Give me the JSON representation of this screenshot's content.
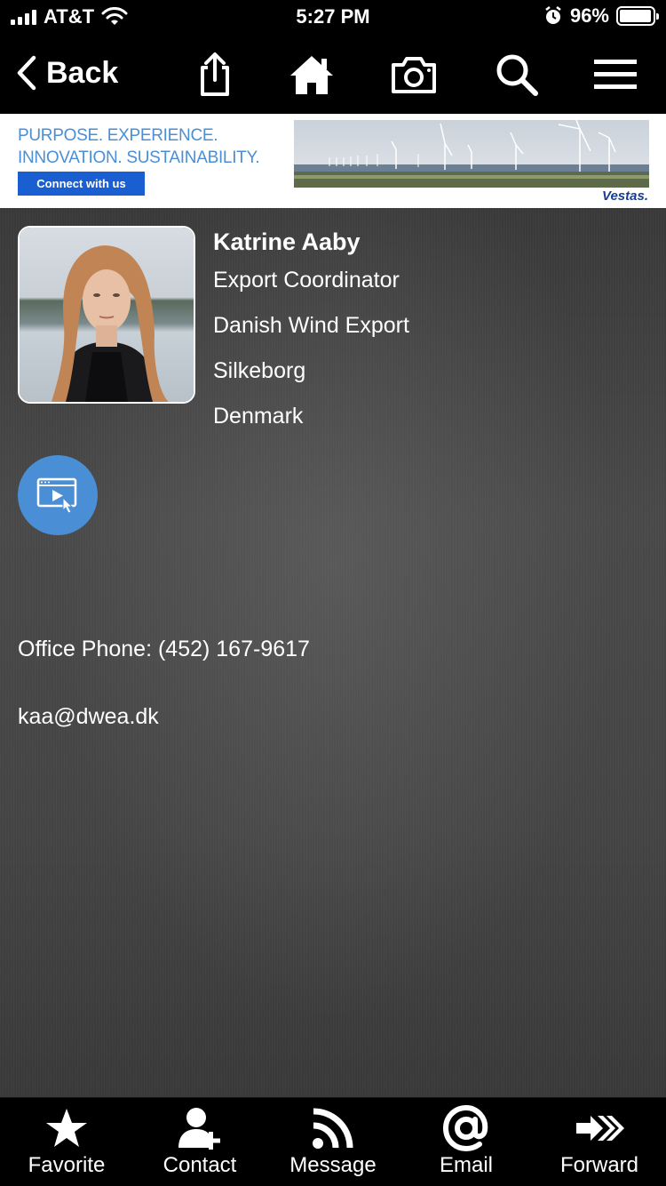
{
  "status": {
    "carrier": "AT&T",
    "time": "5:27 PM",
    "battery": "96%",
    "battery_level": 0.96
  },
  "nav": {
    "back_label": "Back",
    "icons": [
      "share-icon",
      "home-icon",
      "camera-icon",
      "search-icon",
      "menu-icon"
    ]
  },
  "banner": {
    "line1": "PURPOSE. EXPERIENCE.",
    "line2": "INNOVATION. SUSTAINABILITY.",
    "button": "Connect with us",
    "brand": "Vestas."
  },
  "profile": {
    "name": "Katrine Aaby",
    "title": "Export Coordinator",
    "company": "Danish Wind Export",
    "city": "Silkeborg",
    "country": "Denmark",
    "phone": "Office Phone: (452) 167-9617",
    "email": "kaa@dwea.dk"
  },
  "tabs": [
    {
      "label": "Favorite",
      "icon": "star-icon"
    },
    {
      "label": "Contact",
      "icon": "add-contact-icon"
    },
    {
      "label": "Message",
      "icon": "rss-icon"
    },
    {
      "label": "Email",
      "icon": "at-icon"
    },
    {
      "label": "Forward",
      "icon": "forward-icon"
    }
  ],
  "colors": {
    "accent": "#4a8fd6",
    "banner_button": "#1a5fd1",
    "brand": "#1a3d8f"
  }
}
